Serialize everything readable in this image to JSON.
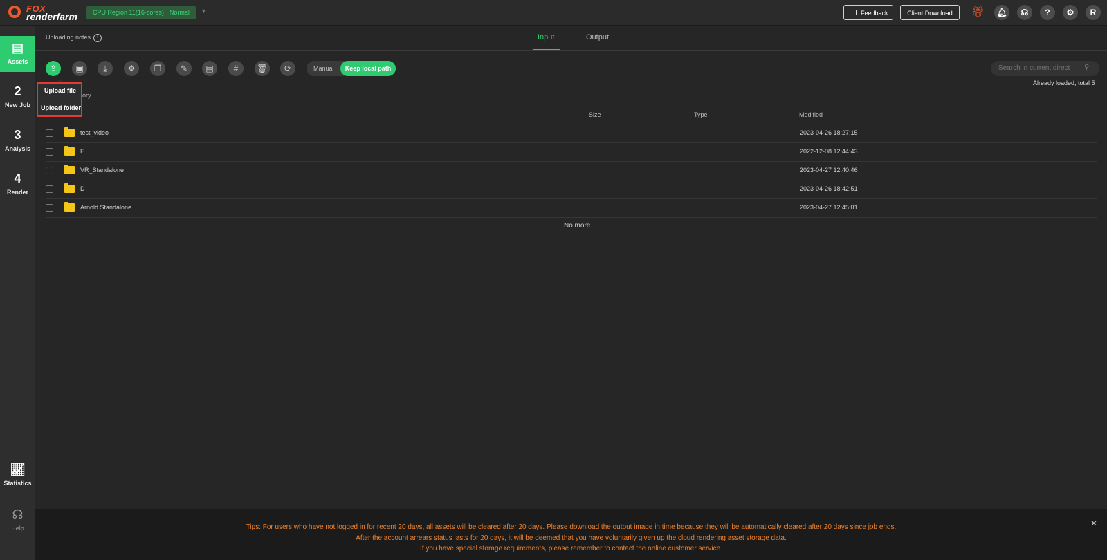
{
  "brand": {
    "line1": "FOX",
    "line2": "renderfarm"
  },
  "region": {
    "name": "CPU Region 11(16-cores)",
    "status": "Normal"
  },
  "header": {
    "feedback_label": "Feedback",
    "client_download_label": "Client Download",
    "avatar_letter": "R"
  },
  "sidebar": {
    "items": [
      {
        "label": "Assets"
      },
      {
        "label": "New Job",
        "step": "2"
      },
      {
        "label": "Analysis",
        "step": "3"
      },
      {
        "label": "Render",
        "step": "4"
      },
      {
        "label": "Statistics"
      },
      {
        "label": "Help"
      }
    ]
  },
  "subheader": {
    "notes_label": "Uploading notes",
    "tabs": [
      {
        "label": "Input"
      },
      {
        "label": "Output"
      }
    ]
  },
  "toolbar": {
    "manual_label": "Manual",
    "keep_local_path_label": "Keep local path",
    "search_placeholder": "Search in current direct",
    "loaded_text": "Already loaded, total 5"
  },
  "upload_menu": {
    "items": [
      "Upload file",
      "Upload folder"
    ]
  },
  "breadcrumb_fragment": "ory",
  "table": {
    "columns": {
      "size": "Size",
      "type": "Type",
      "modified": "Modified"
    },
    "rows": [
      {
        "name": "test_video",
        "modified": "2023-04-26 18:27:15"
      },
      {
        "name": "E",
        "modified": "2022-12-08 12:44:43"
      },
      {
        "name": "VR_Standalone",
        "modified": "2023-04-27 12:40:46"
      },
      {
        "name": "D",
        "modified": "2023-04-26 18:42:51"
      },
      {
        "name": "Arnold Standalone",
        "modified": "2023-04-27 12:45:01"
      }
    ],
    "no_more": "No more"
  },
  "tips": {
    "line1": "Tips: For users who have not logged in for recent 20 days, all assets will be cleared after 20 days. Please download the output image in time because they will be automatically cleared after 20 days since job ends.",
    "line2": "After the account arrears status lasts for 20 days, it will be deemed that you have voluntarily given up the cloud rendering asset storage data.",
    "line3": "If you have special storage requirements, please remember to contact the online customer service."
  },
  "colors": {
    "accent": "#2ecc71",
    "brand": "#f0582b",
    "tip": "#f0822b",
    "highlight": "#e53935"
  }
}
